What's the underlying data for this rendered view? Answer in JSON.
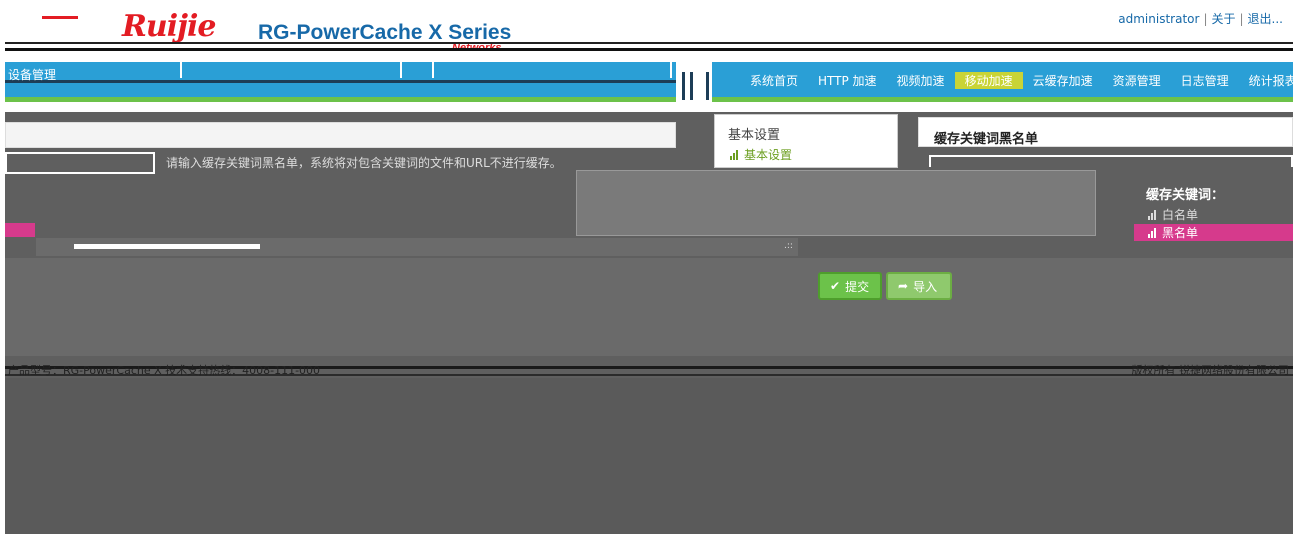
{
  "header": {
    "brand": "Ruijie",
    "product": "RG-PowerCache X Series",
    "networks": "Networks",
    "user_links": [
      "administrator",
      "关于",
      "退出..."
    ]
  },
  "nav": {
    "section_tab": "设备管理",
    "menu": [
      "系统首页",
      "HTTP 加速",
      "视频加速",
      "移动加速",
      "云缓存加速",
      "资源管理",
      "日志管理",
      "统计报表"
    ],
    "active_index": 3
  },
  "left": {
    "hint": "请输入缓存关键词黑名单，系统将对包含关键词的文件和URL不进行缓存。"
  },
  "settings": {
    "title": "基本设置",
    "link": "基本设置"
  },
  "panel": {
    "title": "缓存关键词黑名单",
    "side_heading": "缓存关键词：",
    "items": [
      "白名单",
      "黑名单"
    ],
    "active_item": 1
  },
  "buttons": {
    "submit": "提交",
    "import": "导入"
  },
  "footer": {
    "left": "产品型号：RG-PowerCache X   技术支持热线：4008-111-000",
    "right": "版权所有 锐捷网络股份有限公司"
  },
  "colors": {
    "accent_blue": "#2a9fd6",
    "accent_green": "#6cc24a",
    "brand_red": "#e31c23",
    "highlight_pink": "#d63a8c"
  }
}
